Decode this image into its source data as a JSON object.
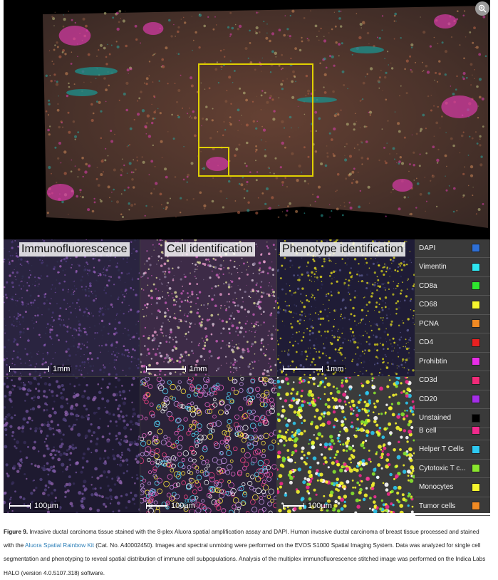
{
  "overview": {
    "zoom_icon": "magnify-plus-icon",
    "highlight_color": "#e0d000"
  },
  "panels": {
    "titles": [
      "Immunofluorescence",
      "Cell identification",
      "Phenotype identification"
    ],
    "scale_top": "1mm",
    "scale_bottom": "100µm"
  },
  "legend": {
    "markers": [
      {
        "label": "DAPI",
        "color": "#2e6fd6"
      },
      {
        "label": "Vimentin",
        "color": "#2ee6f0"
      },
      {
        "label": "CD8a",
        "color": "#2ee62e"
      },
      {
        "label": "CD68",
        "color": "#f5f52e"
      },
      {
        "label": "PCNA",
        "color": "#f08a24"
      },
      {
        "label": "CD4",
        "color": "#e82020"
      },
      {
        "label": "Prohibtin",
        "color": "#e82ee8"
      },
      {
        "label": "CD3d",
        "color": "#f02a78"
      },
      {
        "label": "CD20",
        "color": "#a42ee8"
      },
      {
        "label": "Unstained",
        "color": "#000000"
      }
    ],
    "phenotypes": [
      {
        "label": "B cell",
        "color": "#f02a8c"
      },
      {
        "label": "Helper T Cells",
        "color": "#2ec8f0"
      },
      {
        "label": "Cytotoxic T c...",
        "color": "#8ae62e"
      },
      {
        "label": "Monocytes",
        "color": "#f5f52e"
      },
      {
        "label": "Tumor cells",
        "color": "#f08a24"
      }
    ]
  },
  "caption": {
    "figure": "Figure 9.",
    "text_1": " Invasive ductal carcinoma tissue stained with the 8-plex Aluora spatial amplification assay and DAPI. Human invasive ductal carcinoma of breast tissue processed and stained with the ",
    "link": "Aluora Spatial Rainbow Kit",
    "text_2": " (Cat. No. A40002450). Images and spectral unmixing were performed on the EVOS S1000 Spatial Imaging System. Data was analyzed for single cell segmentation and phenotyping to reveal spatial distribution of immune cell subpopulations. Analysis of the multiplex immunofluorescence stitched image was performed on the Indica Labs HALO (version 4.0.5107.318) software."
  }
}
